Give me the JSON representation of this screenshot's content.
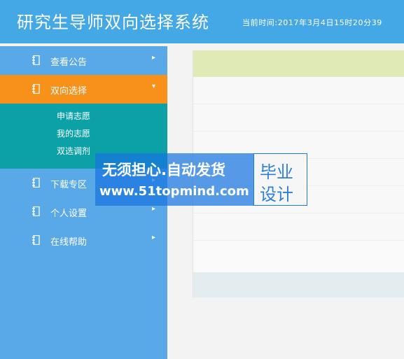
{
  "header": {
    "title": "研究生导师双向选择系统",
    "clock": "当前时间:2017年3月4日15时20分39"
  },
  "sidebar": {
    "items": [
      {
        "label": "查看公告",
        "icon": "notebook-icon",
        "arrow": "▸"
      },
      {
        "label": "双向选择",
        "icon": "notebook-icon",
        "arrow": "▾"
      },
      {
        "label": "下载专区",
        "icon": "notebook-icon",
        "arrow": "▸"
      },
      {
        "label": "个人设置",
        "icon": "notebook-icon",
        "arrow": "▸"
      },
      {
        "label": "在线帮助",
        "icon": "notebook-icon",
        "arrow": "▸"
      }
    ],
    "submenu": [
      "申请志愿",
      "我的志愿",
      "双选调剂"
    ]
  },
  "watermark": {
    "line1": "无须担心.自动发货",
    "line2": "www.51topmind.com",
    "right_line1": "毕业",
    "right_line2": "设计"
  },
  "colors": {
    "header": "#45a8e6",
    "sidebar": "#59a9e8",
    "active": "#f7911a",
    "submenu": "#0ba1a6"
  }
}
